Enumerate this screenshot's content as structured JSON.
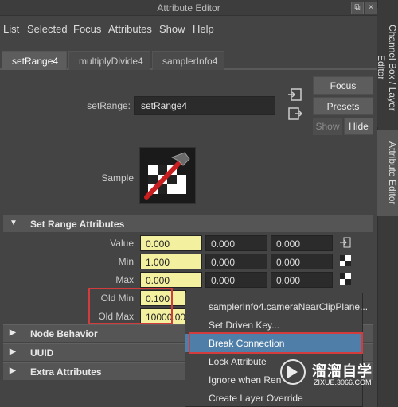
{
  "window": {
    "title": "Attribute Editor"
  },
  "menubar": [
    "List",
    "Selected",
    "Focus",
    "Attributes",
    "Show",
    "Help"
  ],
  "tabs": [
    {
      "label": "setRange4",
      "active": true
    },
    {
      "label": "multiplyDivide4",
      "active": false
    },
    {
      "label": "samplerInfo4",
      "active": false
    }
  ],
  "side_tabs": {
    "channel_box": "Channel Box / Layer Editor",
    "attribute_editor": "Attribute Editor"
  },
  "node": {
    "type_label": "setRange:",
    "name_value": "setRange4",
    "sample_label": "Sample"
  },
  "buttons": {
    "focus": "Focus",
    "presets": "Presets",
    "show": "Show",
    "hide": "Hide"
  },
  "sections": {
    "set_range": "Set Range Attributes",
    "node_behavior": "Node Behavior",
    "uuid": "UUID",
    "extra": "Extra Attributes"
  },
  "attributes": {
    "value": {
      "label": "Value",
      "values": [
        "0.000",
        "0.000",
        "0.000"
      ]
    },
    "min": {
      "label": "Min",
      "values": [
        "1.000",
        "0.000",
        "0.000"
      ]
    },
    "max": {
      "label": "Max",
      "values": [
        "0.000",
        "0.000",
        "0.000"
      ]
    },
    "old_min": {
      "label": "Old Min",
      "values": [
        "0.100"
      ]
    },
    "old_max": {
      "label": "Old Max",
      "values": [
        "10000.000"
      ]
    }
  },
  "context_menu": [
    "samplerInfo4.cameraNearClipPlane...",
    "Set Driven Key...",
    "Break Connection",
    "Lock Attribute",
    "Ignore when Ren",
    "Create Layer Override"
  ],
  "watermark": {
    "brand": "溜溜自学",
    "url": "ZIXUE.3066.COM"
  },
  "colors": {
    "panel_bg": "#444444",
    "highlight": "#4f7fa8",
    "connected_field": "#f3f0a0",
    "annotation_red": "#d23c3c"
  }
}
